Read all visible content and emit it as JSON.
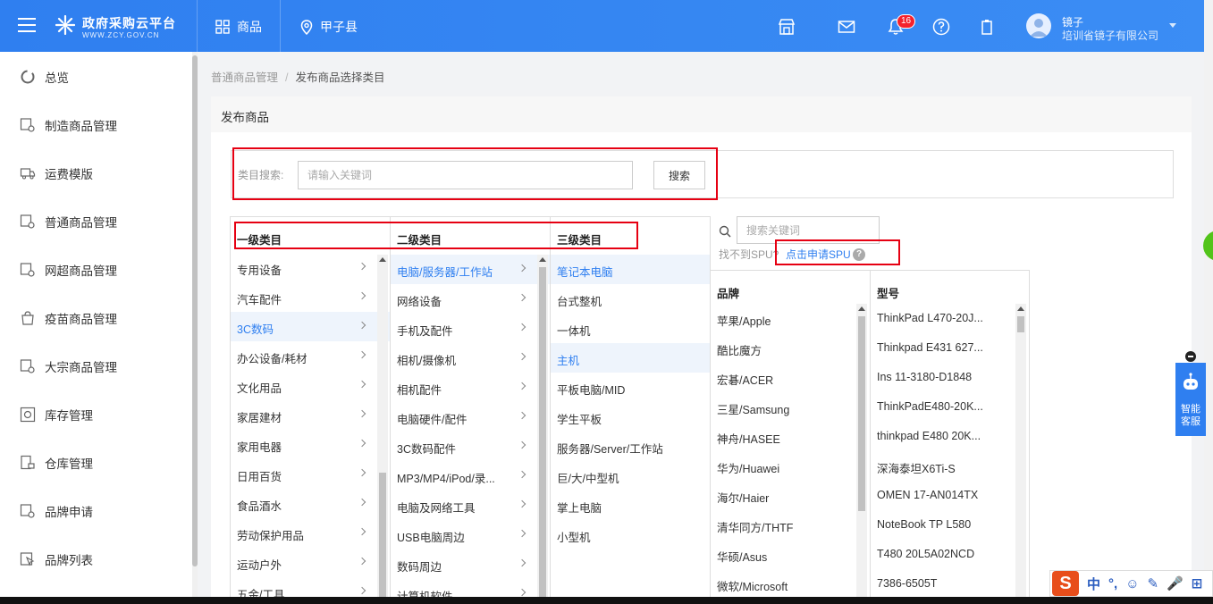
{
  "header": {
    "logo_title": "政府采购云平台",
    "logo_sub": "WWW.ZCY.GOV.CN",
    "nav": [
      {
        "label": "商品",
        "icon": "grid-icon"
      },
      {
        "label": "甲子县",
        "icon": "location-pin-icon"
      }
    ],
    "notification_count": "16",
    "user_name": "镜子",
    "user_org": "培训省镜子有限公司"
  },
  "sidebar": {
    "items": [
      {
        "label": "总览"
      },
      {
        "label": "制造商品管理"
      },
      {
        "label": "运费模版"
      },
      {
        "label": "普通商品管理"
      },
      {
        "label": "网超商品管理"
      },
      {
        "label": "疫苗商品管理"
      },
      {
        "label": "大宗商品管理"
      },
      {
        "label": "库存管理"
      },
      {
        "label": "仓库管理"
      },
      {
        "label": "品牌申请"
      },
      {
        "label": "品牌列表"
      }
    ]
  },
  "breadcrumb": {
    "parent": "普通商品管理",
    "separator": "/",
    "current": "发布商品选择类目"
  },
  "page": {
    "title": "发布商品"
  },
  "category_search": {
    "label": "类目搜索:",
    "placeholder": "请输入关键词",
    "button": "搜索"
  },
  "columns": {
    "level1": {
      "header": "一级类目",
      "items": [
        "专用设备",
        "汽车配件",
        "3C数码",
        "办公设备/耗材",
        "文化用品",
        "家居建材",
        "家用电器",
        "日用百货",
        "食品酒水",
        "劳动保护用品",
        "运动户外",
        "五金/工具"
      ],
      "active": "3C数码"
    },
    "level2": {
      "header": "二级类目",
      "items": [
        "电脑/服务器/工作站",
        "网络设备",
        "手机及配件",
        "相机/摄像机",
        "相机配件",
        "电脑硬件/配件",
        "3C数码配件",
        "MP3/MP4/iPod/录...",
        "电脑及网络工具",
        "USB电脑周边",
        "数码周边",
        "计算机软件"
      ],
      "active": "电脑/服务器/工作站"
    },
    "level3": {
      "header": "三级类目",
      "items": [
        "笔记本电脑",
        "台式整机",
        "一体机",
        "主机",
        "平板电脑/MID",
        "学生平板",
        "服务器/Server/工作站",
        "巨/大/中型机",
        "掌上电脑",
        "小型机"
      ],
      "active": [
        "笔记本电脑",
        "主机"
      ]
    }
  },
  "spu": {
    "search_placeholder": "搜索关键词",
    "hint": "找不到SPU?",
    "link": "点击申请SPU",
    "help": "?",
    "brand_header": "品牌",
    "model_header": "型号",
    "brands": [
      "苹果/Apple",
      "酷比魔方",
      "宏碁/ACER",
      "三星/Samsung",
      "神舟/HASEE",
      "华为/Huawei",
      "海尔/Haier",
      "清华同方/THTF",
      "华硕/Asus",
      "微软/Microsoft"
    ],
    "models": [
      "ThinkPad L470-20J...",
      "Thinkpad E431 627...",
      "Ins 11-3180-D1848",
      "ThinkPadE480-20K...",
      "thinkpad E480 20K...",
      "深海泰坦X6Ti-S",
      "OMEN 17-AN014TX",
      "NoteBook TP L580",
      "T480 20L5A02NCD",
      "7386-6505T"
    ]
  },
  "customer_service": {
    "label": "智能客服"
  },
  "ime": {
    "logo": "S",
    "items": [
      "中",
      "°,",
      "☺",
      "✎",
      "🎤",
      "⊞"
    ]
  },
  "colors": {
    "primary": "#2f7ff0",
    "highlight_box": "#e60012",
    "active_row_bg": "#eef4fc"
  }
}
